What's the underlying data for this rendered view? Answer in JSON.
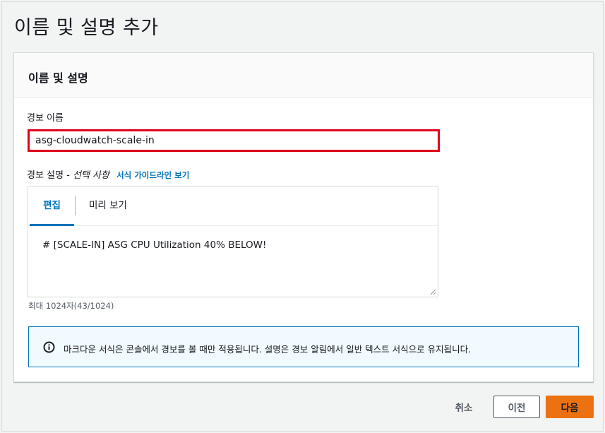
{
  "page": {
    "title": "이름 및 설명 추가"
  },
  "section": {
    "title": "이름 및 설명"
  },
  "alarm_name": {
    "label": "경보 이름",
    "value": "asg-cloudwatch-scale-in"
  },
  "alarm_description": {
    "label": "경보 설명",
    "optional": "- 선택 사항",
    "guide_link": "서식 가이드라인 보기",
    "tabs": [
      {
        "label": "편집",
        "active": true
      },
      {
        "label": "미리 보기",
        "active": false
      }
    ],
    "value": "# [SCALE-IN] ASG CPU Utilization 40% BELOW!",
    "counter": "최대 1024자(43/1024)"
  },
  "info": {
    "icon": "info-icon",
    "text": "마크다운 서식은 콘솔에서 경보를 볼 때만 적용됩니다. 설명은 경보 알림에서 일반 텍스트 서식으로 유지됩니다."
  },
  "footer": {
    "cancel_label": "취소",
    "previous_label": "이전",
    "next_label": "다음"
  },
  "colors": {
    "accent": "#0073bb",
    "primary_button": "#ec7211",
    "error_outline": "#e0001a",
    "info_background": "#f1faff"
  }
}
